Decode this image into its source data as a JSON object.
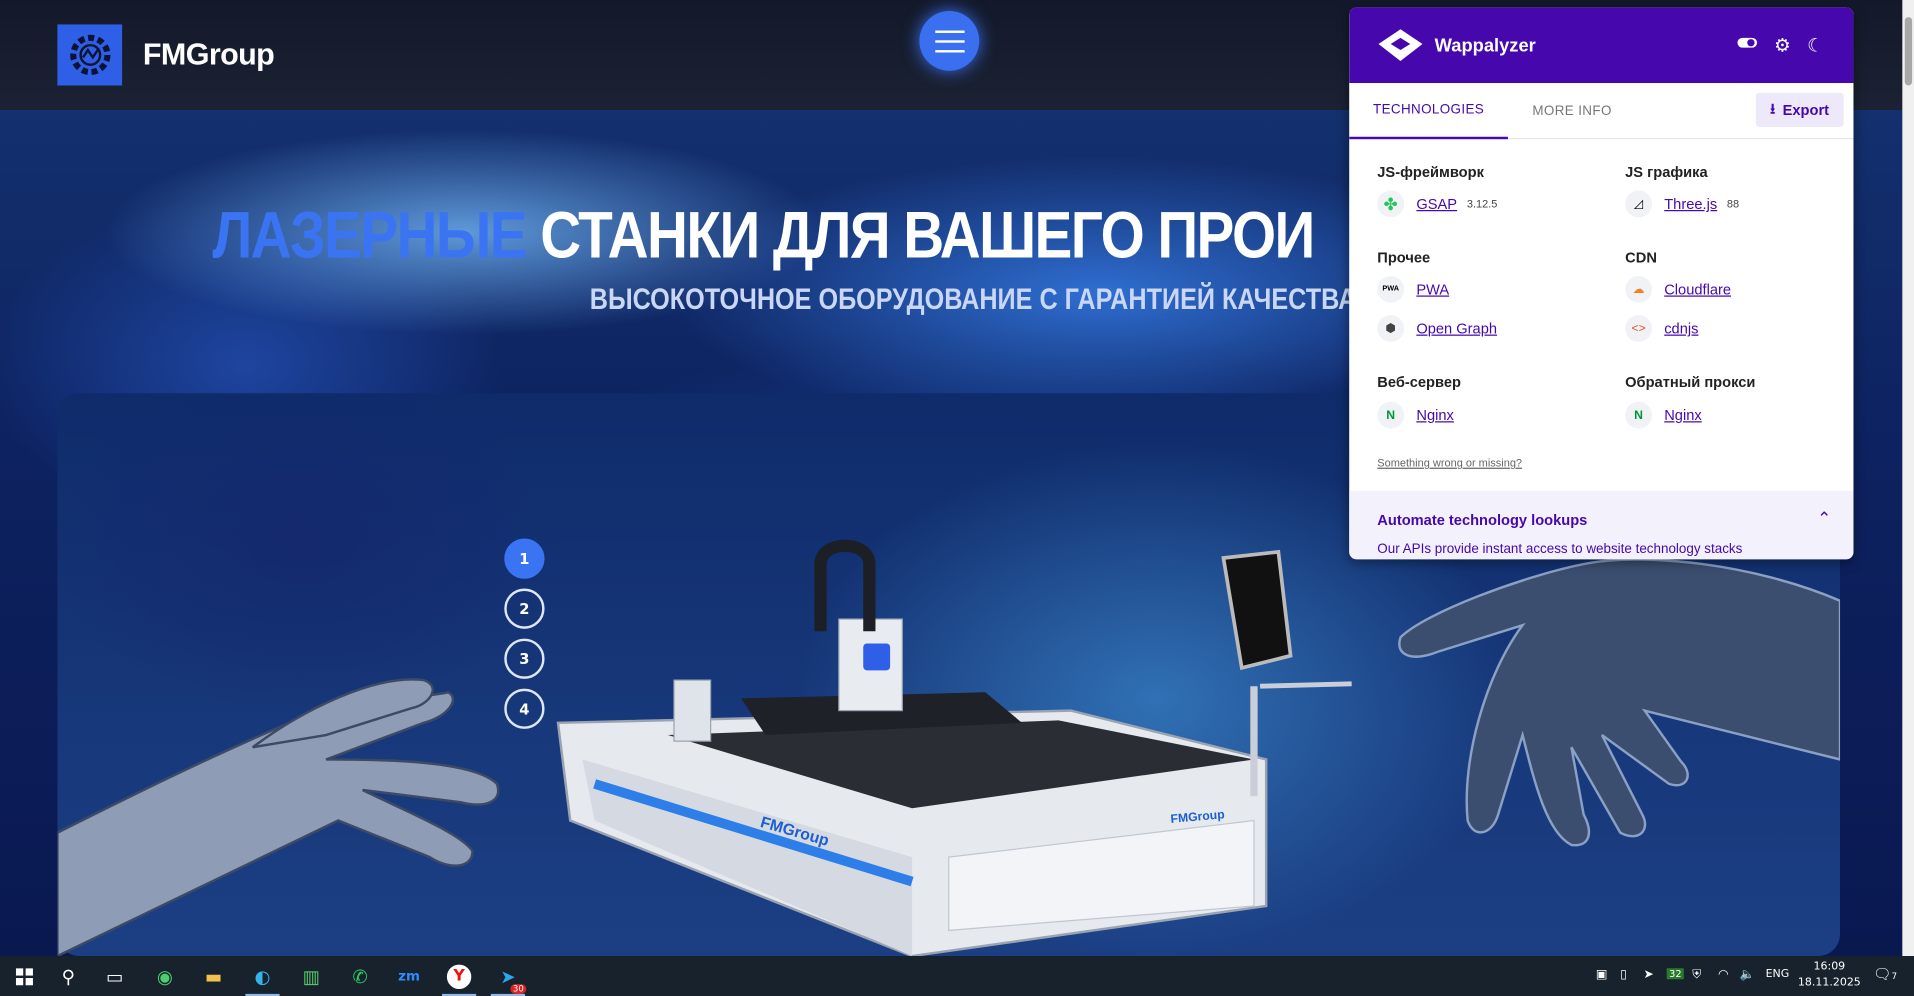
{
  "site": {
    "logo_text": "FMGroup",
    "title_accent": "ЛАЗЕРНЫЕ",
    "title_rest": " СТАНКИ ДЛЯ ВАШЕГО ПРОИ",
    "subtitle": "ВЫСОКОТОЧНОЕ ОБОРУДОВАНИЕ С ГАРАНТИЕЙ КАЧЕСТВА",
    "steps": [
      "1",
      "2",
      "3",
      "4"
    ],
    "active_step": 1,
    "machine_brand": "FMGroup"
  },
  "wappalyzer": {
    "name": "Wappalyzer",
    "tabs": [
      "TECHNOLOGIES",
      "MORE INFO"
    ],
    "export_label": "Export",
    "categories": [
      {
        "name": "JS-фреймворк",
        "items": [
          {
            "name": "GSAP",
            "version": "3.12.5",
            "icon": "gsap-icon"
          }
        ]
      },
      {
        "name": "JS графика",
        "items": [
          {
            "name": "Three.js",
            "version": "88",
            "icon": "threejs-icon"
          }
        ]
      },
      {
        "name": "Прочее",
        "items": [
          {
            "name": "PWA",
            "version": "",
            "icon": "pwa-icon"
          },
          {
            "name": "Open Graph",
            "version": "",
            "icon": "opengraph-icon"
          }
        ]
      },
      {
        "name": "CDN",
        "items": [
          {
            "name": "Cloudflare",
            "version": "",
            "icon": "cloudflare-icon"
          },
          {
            "name": "cdnjs",
            "version": "",
            "icon": "cdnjs-icon"
          }
        ]
      },
      {
        "name": "Веб-сервер",
        "items": [
          {
            "name": "Nginx",
            "version": "",
            "icon": "nginx-icon"
          }
        ]
      },
      {
        "name": "Обратный прокси",
        "items": [
          {
            "name": "Nginx",
            "version": "",
            "icon": "nginx-icon"
          }
        ]
      }
    ],
    "wrong_link": "Something wrong or missing?",
    "automate_title": "Automate technology lookups",
    "automate_text": "Our APIs provide instant access to website technology stacks"
  },
  "taskbar": {
    "language": "ENG",
    "time": "16:09",
    "date": "18.11.2025",
    "telegram_badge": "30",
    "tray_badge": "32",
    "notifications": "7"
  },
  "colors": {
    "accent": "#3b74f2",
    "wappalyzer": "#4608ad"
  }
}
